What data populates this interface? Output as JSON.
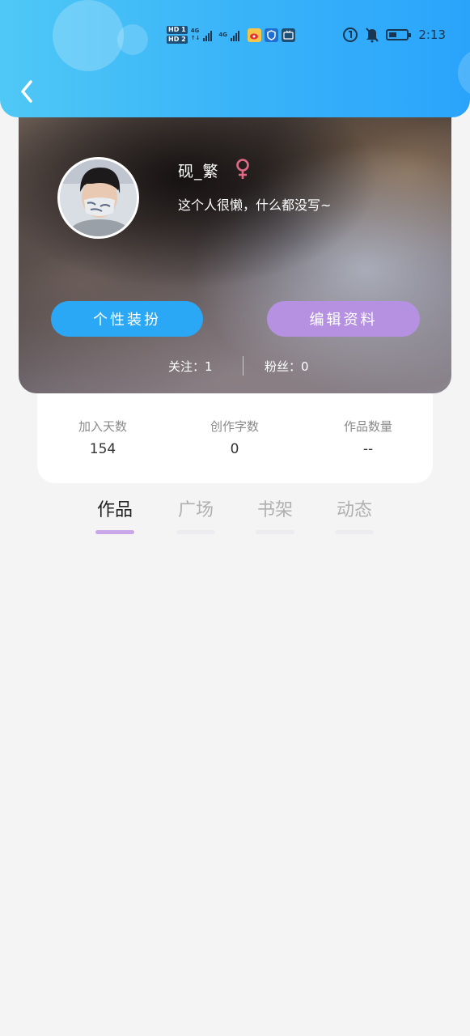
{
  "status_bar": {
    "time": "2:13",
    "hd1": "HD 1",
    "hd2": "HD 2",
    "net1": "4G",
    "net2": "4G",
    "icons": [
      "weibo-icon",
      "shield-icon",
      "tv-icon",
      "hotspot-icon",
      "mute-bell-icon",
      "battery-icon"
    ]
  },
  "profile": {
    "nickname": "砚_繁",
    "gender_symbol": "♀",
    "bio": "这个人很懒，什么都没写~",
    "dress_button": "个性装扮",
    "edit_button": "编辑资料",
    "follow_label": "关注：1",
    "fans_label": "粉丝：0"
  },
  "stats": [
    {
      "label": "加入天数",
      "value": "154"
    },
    {
      "label": "创作字数",
      "value": "0"
    },
    {
      "label": "作品数量",
      "value": "--"
    }
  ],
  "tabs": [
    {
      "label": "作品",
      "active": true
    },
    {
      "label": "广场",
      "active": false
    },
    {
      "label": "书架",
      "active": false
    },
    {
      "label": "动态",
      "active": false
    }
  ],
  "colors": {
    "header_blue": "#3ab4f8",
    "dress_button": "#2ba8f5",
    "edit_button": "#b691e2",
    "tab_indicator": "#c9a7e8",
    "gender_pink": "#e06a86",
    "background": "#f4f4f4"
  }
}
